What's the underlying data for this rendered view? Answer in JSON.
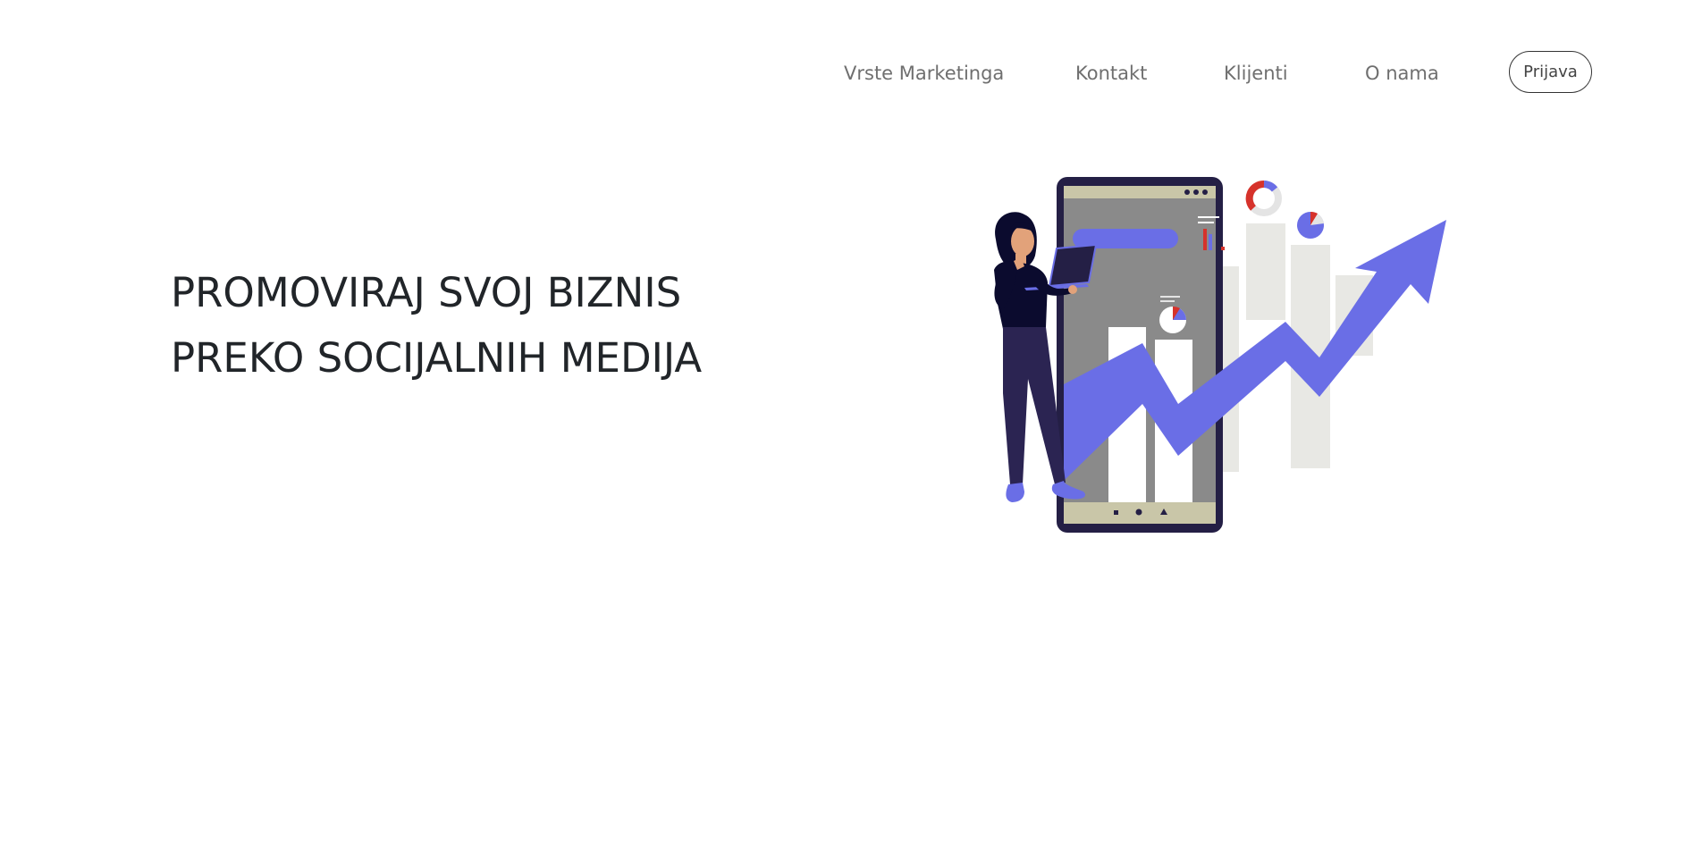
{
  "nav": {
    "links": [
      {
        "label": "Vrste Marketinga"
      },
      {
        "label": "Kontakt"
      },
      {
        "label": "Klijenti"
      },
      {
        "label": "O nama"
      }
    ],
    "login_label": "Prijava"
  },
  "hero": {
    "title_line1": "PROMOVIRAJ SVOJ BIZNIS",
    "title_line2": "PREKO SOCIJALNIH MEDIJA"
  },
  "illustration": {
    "icon": "woman-with-laptop-growth-chart-illustration",
    "colors": {
      "accent": "#6a6ee6",
      "phone_frame": "#241f45",
      "phone_screen": "#8a8a8a",
      "bar_light": "#e8e8e4",
      "red": "#d6322b",
      "figure_dark": "#0b0b2e",
      "pants": "#2b2452",
      "skin": "#e2a27a"
    }
  }
}
